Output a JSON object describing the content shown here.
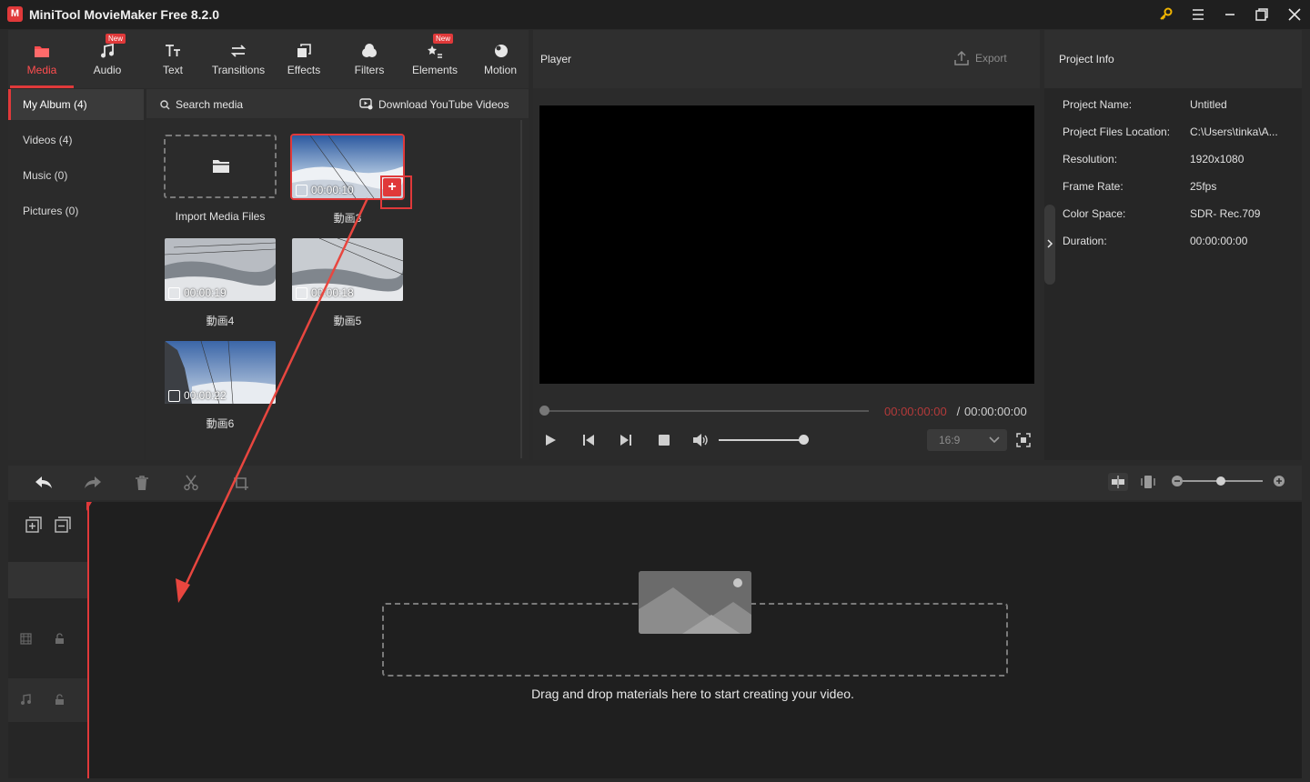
{
  "app": {
    "logo_letter": "M",
    "title": "MiniTool MovieMaker Free 8.2.0"
  },
  "toolbar": {
    "tabs": [
      {
        "label": "Media",
        "icon": "media-icon",
        "active": true
      },
      {
        "label": "Audio",
        "icon": "music-note-icon",
        "badge": "New"
      },
      {
        "label": "Text",
        "icon": "text-icon"
      },
      {
        "label": "Transitions",
        "icon": "transitions-icon"
      },
      {
        "label": "Effects",
        "icon": "effects-icon"
      },
      {
        "label": "Filters",
        "icon": "filters-icon"
      },
      {
        "label": "Elements",
        "icon": "elements-icon",
        "badge": "New"
      },
      {
        "label": "Motion",
        "icon": "motion-icon"
      }
    ]
  },
  "album": {
    "items": [
      {
        "label": "My Album (4)",
        "active": true
      },
      {
        "label": "Videos (4)"
      },
      {
        "label": "Music (0)"
      },
      {
        "label": "Pictures (0)"
      }
    ]
  },
  "media": {
    "search_label": "Search media",
    "youtube_label": "Download YouTube Videos",
    "import_label": "Import Media Files",
    "add_symbol": "+",
    "clips": [
      {
        "name": "動画3",
        "duration": "00:00:10",
        "selected": true
      },
      {
        "name": "動画4",
        "duration": "00:00:19"
      },
      {
        "name": "動画5",
        "duration": "00:00:18"
      },
      {
        "name": "動画6",
        "duration": "00:00:22"
      }
    ]
  },
  "player": {
    "title": "Player",
    "export_label": "Export",
    "time_current": "00:00:00:00",
    "time_separator": " / ",
    "time_total": "00:00:00:00",
    "aspect_ratio": "16:9",
    "volume_level": 0.9,
    "progress": 0
  },
  "project_info": {
    "title": "Project Info",
    "rows": [
      {
        "key": "Project Name:",
        "value": "Untitled"
      },
      {
        "key": "Project Files Location:",
        "value": "C:\\Users\\tinka\\A..."
      },
      {
        "key": "Resolution:",
        "value": "1920x1080"
      },
      {
        "key": "Frame Rate:",
        "value": "25fps"
      },
      {
        "key": "Color Space:",
        "value": "SDR- Rec.709"
      },
      {
        "key": "Duration:",
        "value": "00:00:00:00"
      }
    ]
  },
  "timeline": {
    "drop_text": "Drag and drop materials here to start creating your video.",
    "zoom_level": 0.45
  },
  "colors": {
    "accent": "#e0393a",
    "annotation_arrow": "#e8463f"
  }
}
